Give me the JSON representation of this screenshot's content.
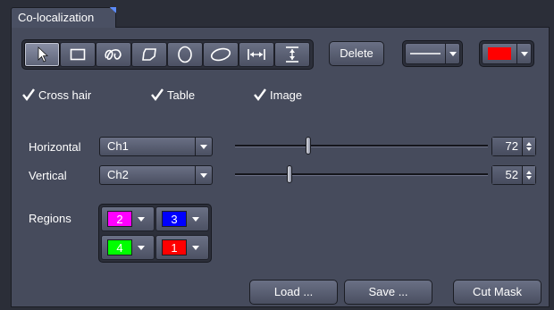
{
  "window": {
    "tab_title": "Co-localization"
  },
  "toolbar": {
    "tools": [
      {
        "icon": "arrow-pointer-icon"
      },
      {
        "icon": "rectangle-icon"
      },
      {
        "icon": "freehand-icon"
      },
      {
        "icon": "polygon-icon"
      },
      {
        "icon": "circle-icon"
      },
      {
        "icon": "ellipse-icon"
      },
      {
        "icon": "horizontal-measure-icon"
      },
      {
        "icon": "vertical-measure-icon"
      }
    ],
    "delete_label": "Delete",
    "line_style": "solid",
    "color": "#ff0000"
  },
  "options": {
    "cross_hair": {
      "label": "Cross hair",
      "checked": true
    },
    "table": {
      "label": "Table",
      "checked": true
    },
    "image": {
      "label": "Image",
      "checked": true
    }
  },
  "channels": {
    "horizontal": {
      "label": "Horizontal",
      "channel": "Ch1",
      "value": "72"
    },
    "vertical": {
      "label": "Vertical",
      "channel": "Ch2",
      "value": "52"
    }
  },
  "regions": {
    "label": "Regions",
    "items": [
      {
        "number": "2",
        "color": "#ff00ff"
      },
      {
        "number": "3",
        "color": "#0000ff"
      },
      {
        "number": "4",
        "color": "#00ff00"
      },
      {
        "number": "1",
        "color": "#ff0000"
      }
    ]
  },
  "footer": {
    "load_label": "Load ...",
    "save_label": "Save ...",
    "cut_mask_label": "Cut Mask"
  }
}
